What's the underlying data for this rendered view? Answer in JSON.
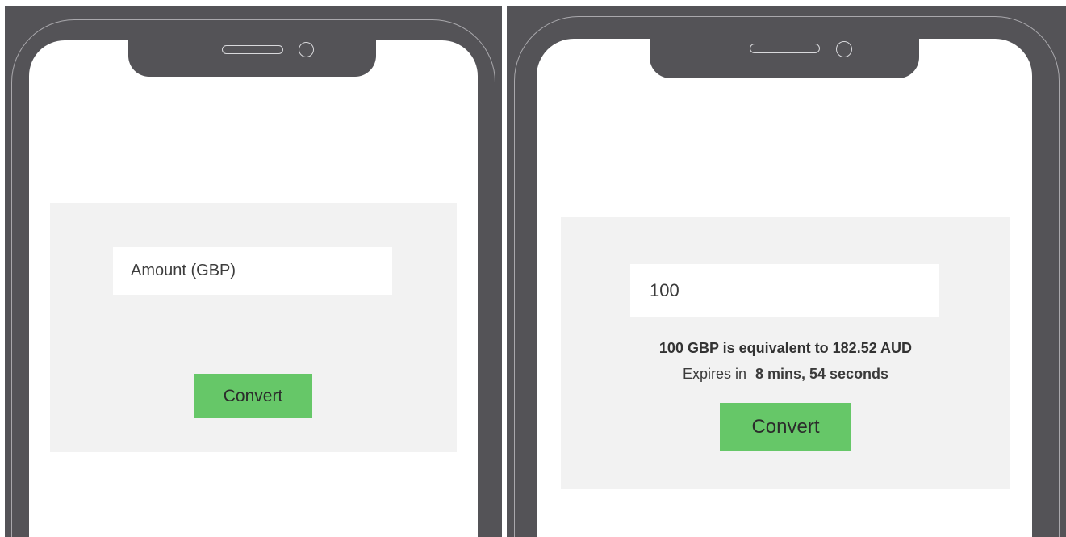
{
  "left_phone": {
    "amount_field": {
      "value": "",
      "placeholder": "Amount (GBP)"
    },
    "convert_label": "Convert"
  },
  "right_phone": {
    "amount_field": {
      "value": "100",
      "placeholder": "Amount (GBP)"
    },
    "result_text": "100 GBP is equivalent to 182.52 AUD",
    "expires_prefix": "Expires in",
    "expires_value": "8 mins, 54 seconds",
    "convert_label": "Convert"
  },
  "colors": {
    "device_body": "#545357",
    "screen_bg": "#ffffff",
    "card_bg": "#f2f2f2",
    "button_green": "#66c768"
  }
}
